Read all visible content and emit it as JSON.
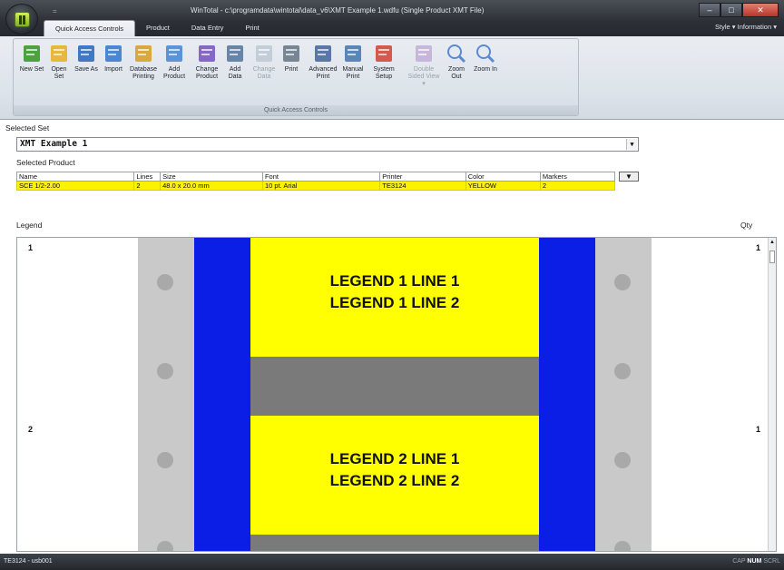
{
  "window": {
    "title": "WinTotal - c:\\programdata\\wintotal\\data_v6\\XMT Example 1.wdfu (Single Product XMT File)",
    "qat_marker": "=",
    "controls": {
      "minimize": "–",
      "maximize": "□",
      "close": "✕"
    }
  },
  "ribbon": {
    "tabs": [
      "Quick Access Controls",
      "Product",
      "Data Entry",
      "Print"
    ],
    "active_tab": "Quick Access Controls",
    "style_menu": "Style  ▾  Information  ▾",
    "group_label": "Quick Access Controls",
    "buttons": [
      {
        "label": "New Set",
        "icon": "new-set-icon",
        "color": "#3a9a2a"
      },
      {
        "label": "Open Set",
        "icon": "folder-icon",
        "color": "#e7b12a"
      },
      {
        "label": "Save As",
        "icon": "save-as-icon",
        "color": "#2d6cc0"
      },
      {
        "label": "Import",
        "icon": "import-icon",
        "color": "#3a7bd0"
      },
      {
        "label": "Database Printing",
        "icon": "database-icon",
        "color": "#d8a12a"
      },
      {
        "label": "Add Product",
        "icon": "add-product-icon",
        "color": "#4a8ad6"
      },
      {
        "label": "Change Product",
        "icon": "change-product-icon",
        "color": "#7a5ac0"
      },
      {
        "label": "Add Data",
        "icon": "add-data-icon",
        "color": "#5a7aa0"
      },
      {
        "label": "Change Data",
        "icon": "change-data-icon",
        "color": "#9aaabc",
        "disabled": true
      },
      {
        "label": "Print",
        "icon": "printer-icon",
        "color": "#6a7a8a"
      },
      {
        "label": "Advanced Print",
        "icon": "advanced-print-icon",
        "color": "#4a6aa0"
      },
      {
        "label": "Manual Print",
        "icon": "manual-print-icon",
        "color": "#4a7ab0"
      },
      {
        "label": "System Setup",
        "icon": "system-setup-icon",
        "color": "#d04a3a"
      },
      {
        "label": "Double Sided View ▾",
        "icon": "double-sided-view-icon",
        "color": "#a07ac0",
        "disabled": true
      },
      {
        "label": "Zoom Out",
        "icon": "zoom-out-icon",
        "color": "#5a8ad6"
      },
      {
        "label": "Zoom In",
        "icon": "zoom-in-icon",
        "color": "#5a8ad6"
      }
    ]
  },
  "selected_set": {
    "label": "Selected Set",
    "value": "XMT Example 1"
  },
  "selected_product": {
    "label": "Selected Product",
    "columns": [
      "Name",
      "Lines",
      "Size",
      "Font",
      "Printer",
      "Color",
      "Markers"
    ],
    "row": [
      "SCE 1/2-2.00",
      "2",
      "48.0 x 20.0 mm",
      "10 pt. Arial",
      "TE3124",
      "YELLOW",
      "2"
    ],
    "highlight_color": "#fbf200"
  },
  "legend": {
    "label": "Legend",
    "qty_label": "Qty",
    "markers": [
      {
        "index": "1",
        "qty": "1",
        "lines": [
          "LEGEND 1 LINE 1",
          "LEGEND 1 LINE 2"
        ]
      },
      {
        "index": "2",
        "qty": "1",
        "lines": [
          "LEGEND 2 LINE 1",
          "LEGEND 2 LINE 2"
        ]
      }
    ],
    "marker_color": "#ffff00",
    "band_color": "#0a1ee6"
  },
  "status": {
    "left": "TE3124 - usb001",
    "right_prefix": "CAP ",
    "right_bold": "NUM",
    "right_suffix": " SCRL"
  }
}
